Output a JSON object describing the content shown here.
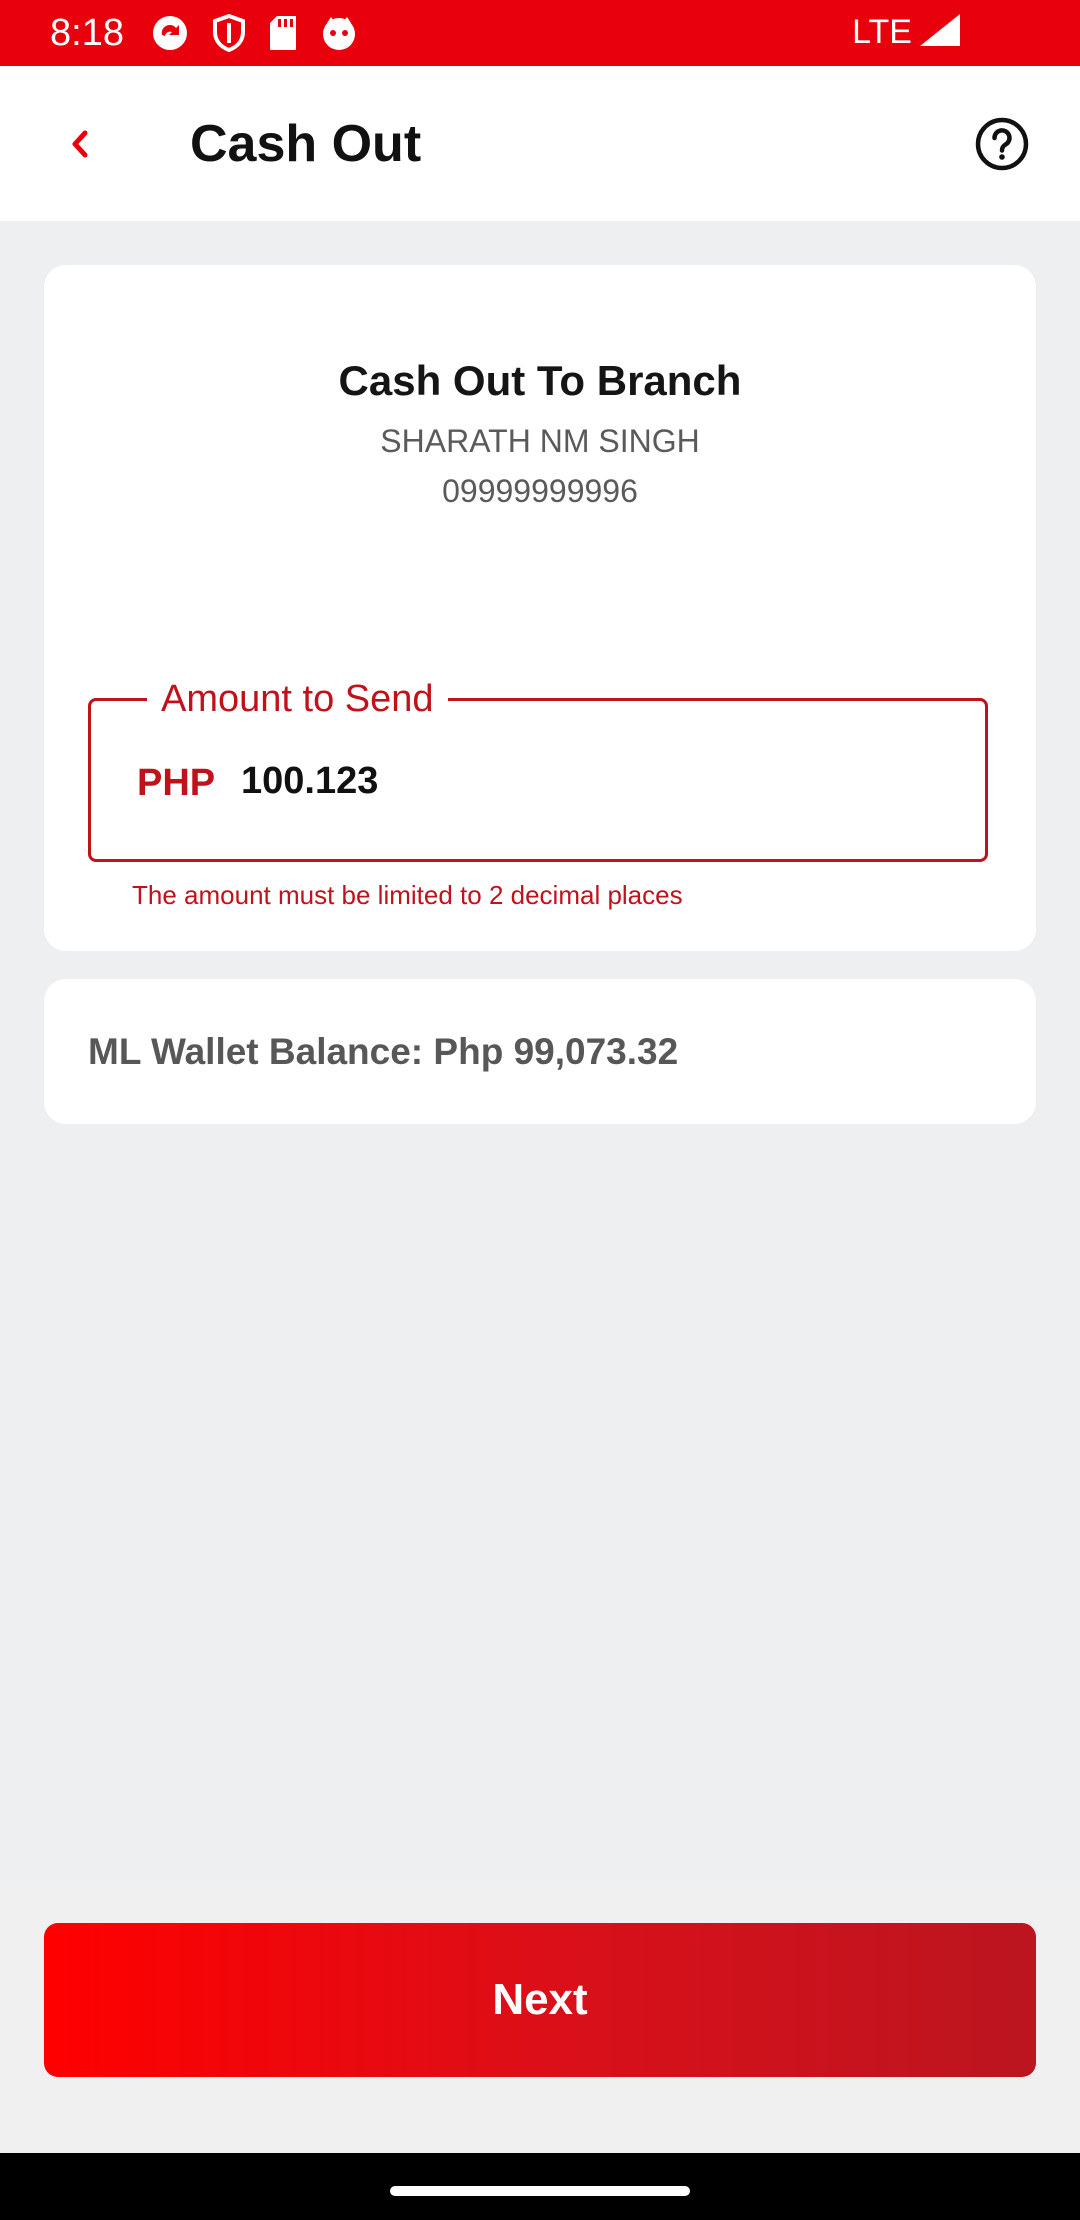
{
  "status_bar": {
    "time": "8:18",
    "network": "LTE",
    "background_color": "#e8000c",
    "icons": [
      "sync-icon",
      "shield-icon",
      "sd-card-icon",
      "face-icon",
      "signal-icon"
    ]
  },
  "header": {
    "title": "Cash Out",
    "back_icon": "chevron-left-icon",
    "help_icon": "help-circle-icon"
  },
  "recipient": {
    "title": "Cash Out To Branch",
    "name": "SHARATH NM SINGH",
    "number": "09999999996"
  },
  "amount": {
    "label": "Amount to Send",
    "currency": "PHP",
    "value": "100.123",
    "error": "The amount must be limited to 2 decimal places",
    "error_color": "#c0121b"
  },
  "balance": {
    "text": "ML Wallet Balance: Php 99,073.32"
  },
  "footer": {
    "next_label": "Next",
    "accent_color": "#ff0000"
  }
}
